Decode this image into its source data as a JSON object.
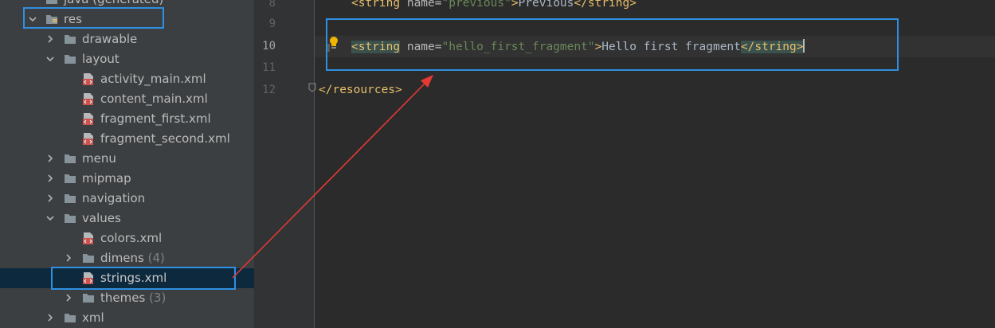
{
  "project_tree": {
    "rows": [
      {
        "label": "java (generated)",
        "indent": 0
      },
      {
        "label": "res",
        "indent": 0
      },
      {
        "label": "drawable",
        "indent": 1
      },
      {
        "label": "layout",
        "indent": 1
      },
      {
        "label": "activity_main.xml",
        "indent": 2
      },
      {
        "label": "content_main.xml",
        "indent": 2
      },
      {
        "label": "fragment_first.xml",
        "indent": 2
      },
      {
        "label": "fragment_second.xml",
        "indent": 2
      },
      {
        "label": "menu",
        "indent": 1
      },
      {
        "label": "mipmap",
        "indent": 1
      },
      {
        "label": "navigation",
        "indent": 1
      },
      {
        "label": "values",
        "indent": 1
      },
      {
        "label": "colors.xml",
        "indent": 2
      },
      {
        "label": "dimens",
        "count": "(4)",
        "indent": 2
      },
      {
        "label": "strings.xml",
        "indent": 2,
        "selected": true
      },
      {
        "label": "themes",
        "count": "(3)",
        "indent": 2
      },
      {
        "label": "xml",
        "indent": 1
      }
    ]
  },
  "editor": {
    "line_numbers": [
      "8",
      "9",
      "10",
      "11",
      "12"
    ],
    "current_line": "10",
    "lines": {
      "l8": {
        "open": "<string",
        "attr": " name=",
        "value": "\"previous\"",
        "close": ">",
        "text": "Previous",
        "end": "</string>"
      },
      "l10": {
        "open": "<string",
        "attr": " name=",
        "value": "\"hello_first_fragment\"",
        "close": ">",
        "text": "Hello first fragment",
        "end": "</string>"
      },
      "l12": {
        "end": "</resources>"
      }
    }
  },
  "colors": {
    "tree_bg": "#3c3f41",
    "editor_bg": "#2b2b2b",
    "selection": "#0d293e",
    "annotation_box": "#2f8fe0",
    "annotation_arrow": "#e53935",
    "xml_tag": "#e8bf6a",
    "xml_string": "#6a8759"
  }
}
